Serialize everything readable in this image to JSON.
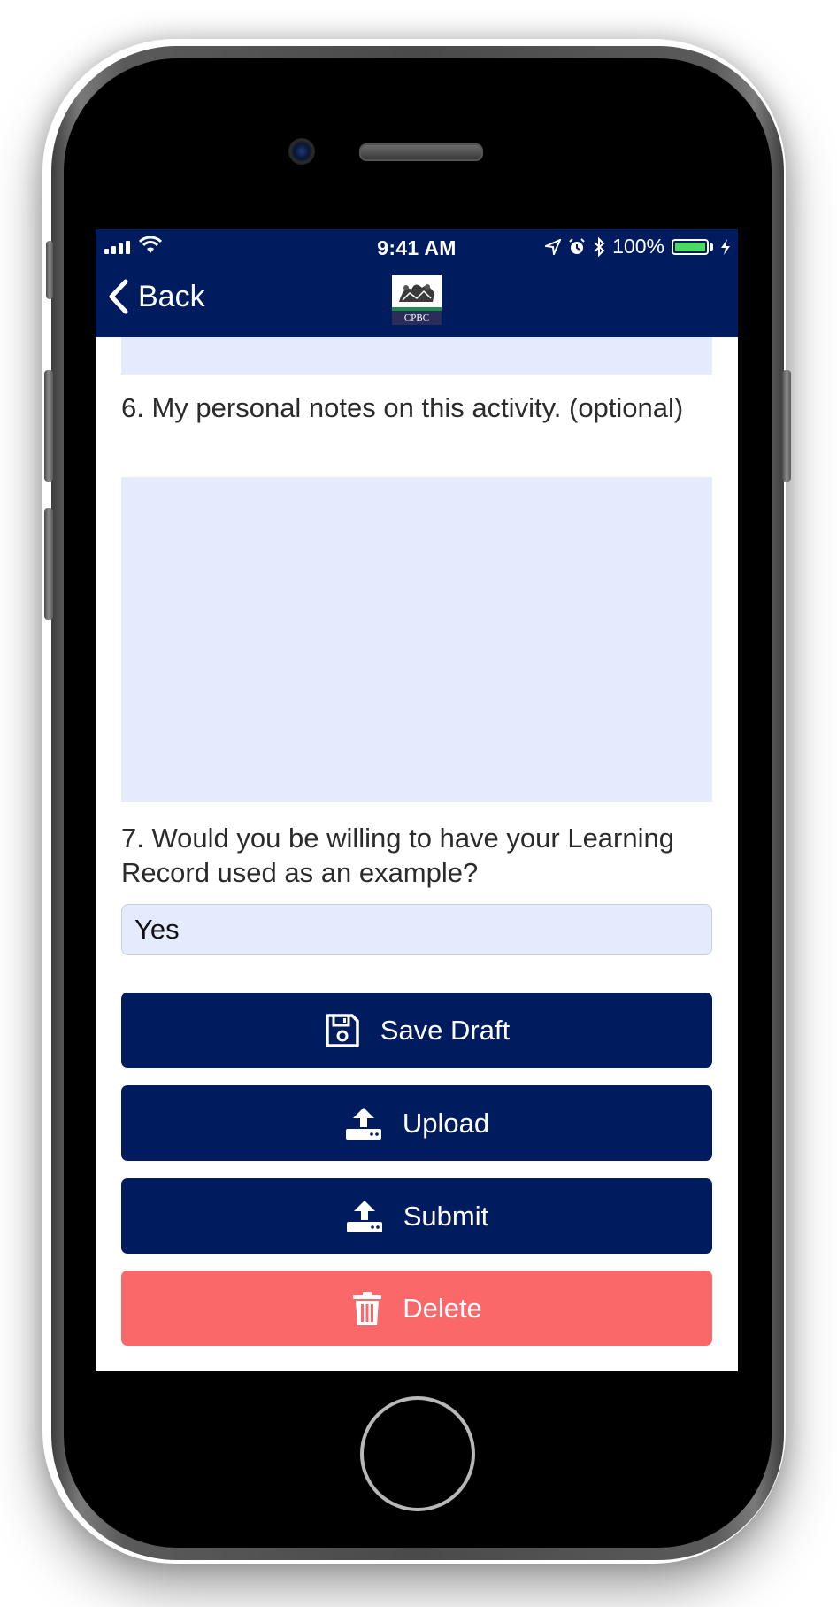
{
  "status_bar": {
    "time": "9:41 AM",
    "battery": "100%",
    "icons": [
      "signal-icon",
      "wifi-icon",
      "location-icon",
      "alarm-icon",
      "bluetooth-icon",
      "battery-icon",
      "charging-icon"
    ]
  },
  "nav": {
    "back_label": "Back",
    "logo_text": "CPBC"
  },
  "form": {
    "q6_label": "6. My personal notes on this activity. (optional)",
    "q6_value": "",
    "q7_label": "7. Would you be willing to have your Learning Record used as an example?",
    "q7_value": "Yes"
  },
  "actions": {
    "save_draft": "Save Draft",
    "upload": "Upload",
    "submit": "Submit",
    "delete": "Delete"
  },
  "colors": {
    "header": "#001c5e",
    "primary_button": "#001c5e",
    "danger_button": "#fb6869",
    "field_background": "#e4ebfc",
    "battery_fill": "#4cd964"
  }
}
